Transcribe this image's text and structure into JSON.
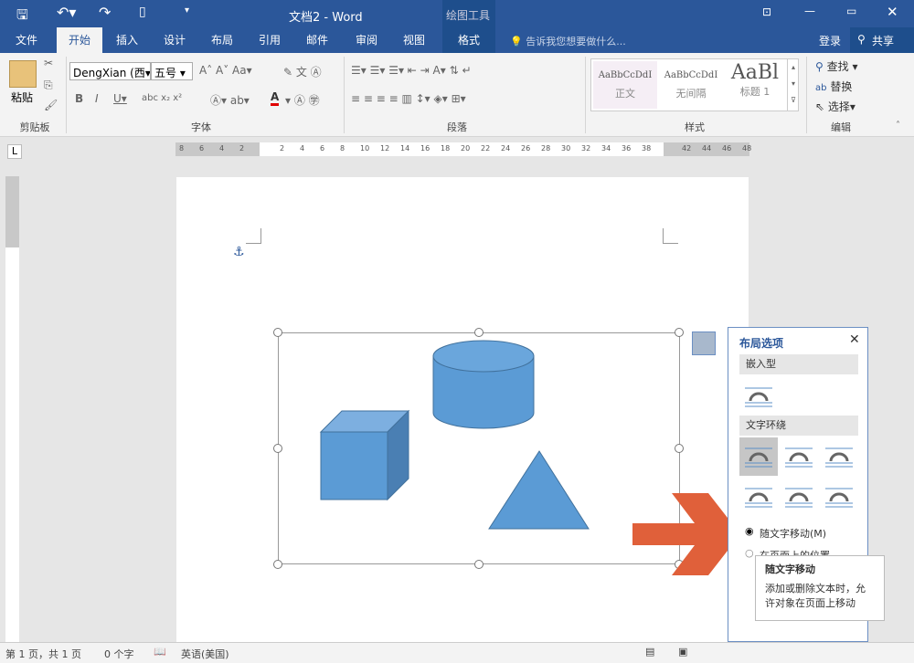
{
  "window": {
    "title": "文档2 - Word",
    "context_tab_group": "绘图工具"
  },
  "tabs": [
    "文件",
    "开始",
    "插入",
    "设计",
    "布局",
    "引用",
    "邮件",
    "审阅",
    "视图",
    "格式"
  ],
  "active_tab": "开始",
  "tell_me": "告诉我您想要做什么...",
  "signin": "登录",
  "share": "共享",
  "ribbon": {
    "clipboard": {
      "paste": "粘贴",
      "label": "剪贴板"
    },
    "font": {
      "name": "DengXian (西",
      "size": "五号",
      "label": "字体",
      "font_color": "#e00000"
    },
    "paragraph": {
      "label": "段落"
    },
    "styles": {
      "label": "样式",
      "items": [
        {
          "preview": "AaBbCcDdI",
          "name": "正文"
        },
        {
          "preview": "AaBbCcDdI",
          "name": "无间隔"
        },
        {
          "preview": "AaBl",
          "name": "标题 1"
        }
      ]
    },
    "editing": {
      "label": "编辑",
      "find": "查找",
      "replace": "替换",
      "select": "选择"
    }
  },
  "ruler": {
    "ticks": [
      "8",
      "6",
      "4",
      "2",
      "",
      "2",
      "4",
      "6",
      "8",
      "10",
      "12",
      "14",
      "16",
      "18",
      "20",
      "22",
      "24",
      "26",
      "28",
      "30",
      "32",
      "34",
      "36",
      "38",
      "",
      "42",
      "44",
      "46",
      "48"
    ]
  },
  "layout_panel": {
    "title": "布局选项",
    "inline_section": "嵌入型",
    "wrap_section": "文字环绕",
    "option_move": "随文字移动(M)",
    "option_fix": "在页面上的位置",
    "move_selected": true
  },
  "tooltip": {
    "title": "随文字移动",
    "body": "添加或删除文本时，允许对象在页面上移动"
  },
  "status": {
    "page": "第 1 页，共 1 页",
    "words": "0 个字",
    "language": "英语(美国)"
  },
  "colors": {
    "accent": "#2b579a",
    "shape": "#5b9bd5",
    "arrow": "#e0603a"
  }
}
